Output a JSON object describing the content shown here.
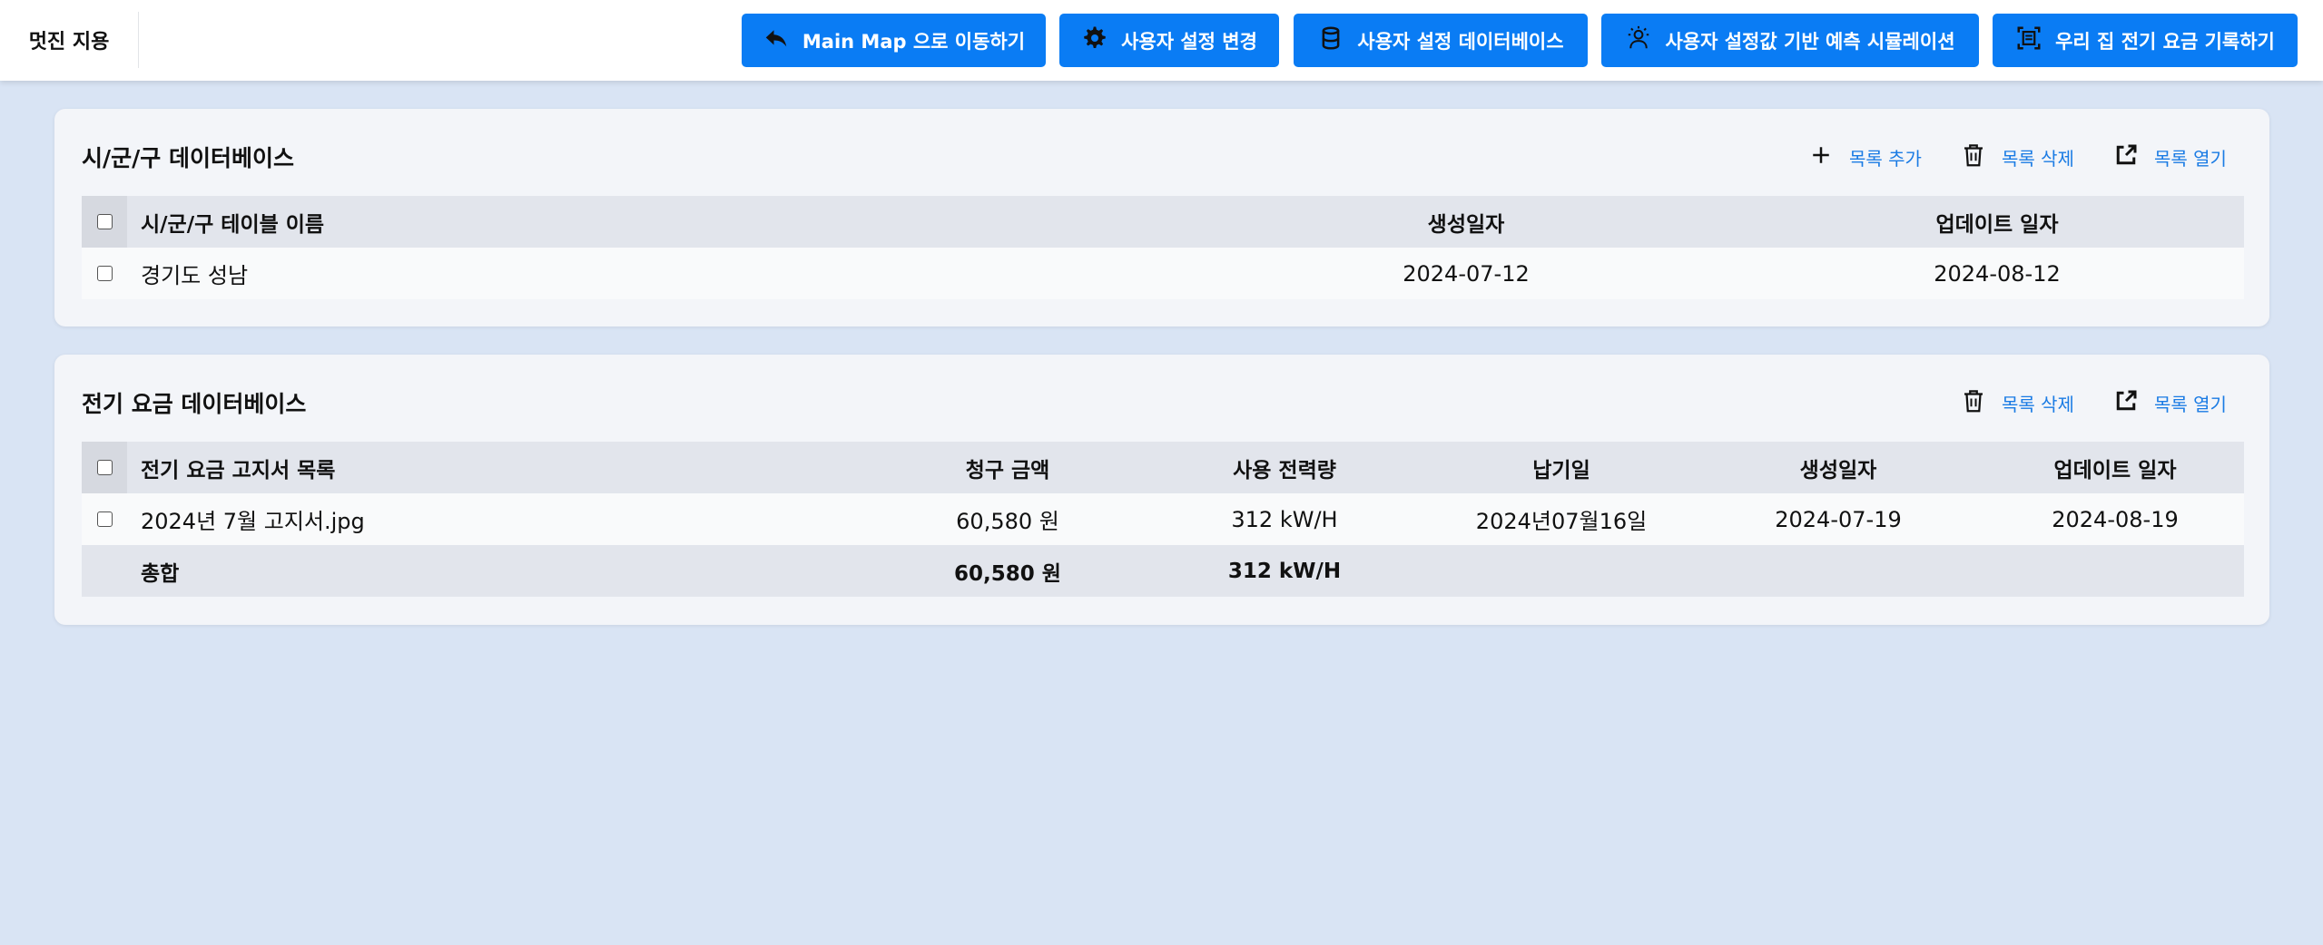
{
  "app": {
    "title": "멋진 지용"
  },
  "nav": [
    {
      "label": "Main Map 으로 이동하기",
      "icon": "reply-arrow-icon"
    },
    {
      "label": "사용자 설정 변경",
      "icon": "gear-icon"
    },
    {
      "label": "사용자 설정 데이터베이스",
      "icon": "database-icon"
    },
    {
      "label": "사용자 설정값 기반 예측 시뮬레이션",
      "icon": "person-idea-icon"
    },
    {
      "label": "우리 집 전기 요금 기록하기",
      "icon": "scan-document-icon"
    }
  ],
  "city_db": {
    "title": "시/군/구 데이터베이스",
    "actions": {
      "add": "목록 추가",
      "delete": "목록 삭제",
      "open": "목록 열기"
    },
    "columns": [
      "시/군/구 테이블 이름",
      "생성일자",
      "업데이트 일자"
    ],
    "rows": [
      {
        "name": "경기도 성남",
        "created": "2024-07-12",
        "updated": "2024-08-12"
      }
    ]
  },
  "bill_db": {
    "title": "전기 요금 데이터베이스",
    "actions": {
      "delete": "목록 삭제",
      "open": "목록 열기"
    },
    "columns": [
      "전기 요금 고지서 목록",
      "청구 금액",
      "사용 전력량",
      "납기일",
      "생성일자",
      "업데이트 일자"
    ],
    "rows": [
      {
        "name": "2024년 7월 고지서.jpg",
        "amount": "60,580 원",
        "usage": "312 kW/H",
        "due": "2024년07월16일",
        "created": "2024-07-19",
        "updated": "2024-08-19"
      }
    ],
    "total": {
      "label": "총합",
      "amount": "60,580 원",
      "usage": "312 kW/H"
    }
  },
  "colors": {
    "accent": "#0a7cf4",
    "background": "#d9e4f4",
    "link": "#1a7be4"
  }
}
